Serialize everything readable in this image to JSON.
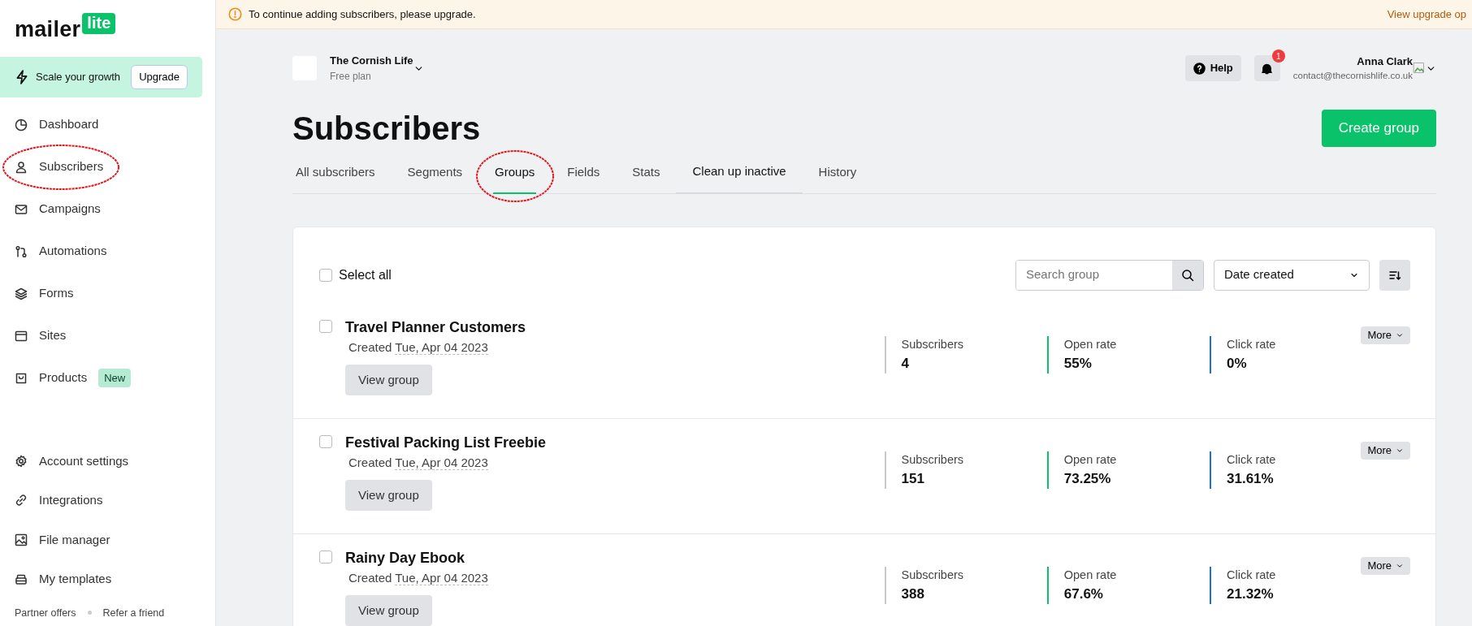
{
  "banner": {
    "text": "To continue adding subscribers, please upgrade.",
    "link": "View upgrade op"
  },
  "sidebar": {
    "logo": {
      "word": "mailer",
      "tag": "lite"
    },
    "promo": {
      "text": "Scale your growth",
      "button": "Upgrade"
    },
    "nav": [
      {
        "label": "Dashboard",
        "circled": false
      },
      {
        "label": "Subscribers",
        "circled": true
      },
      {
        "label": "Campaigns",
        "circled": false
      },
      {
        "label": "Automations",
        "circled": false
      },
      {
        "label": "Forms",
        "circled": false
      },
      {
        "label": "Sites",
        "circled": false
      },
      {
        "label": "Products",
        "circled": false,
        "badge": "New"
      }
    ],
    "settings": [
      {
        "label": "Account settings"
      },
      {
        "label": "Integrations"
      },
      {
        "label": "File manager"
      },
      {
        "label": "My templates"
      }
    ],
    "footer": [
      "Partner offers",
      "Refer a friend"
    ]
  },
  "account": {
    "name": "The Cornish Life",
    "plan": "Free plan"
  },
  "help": "Help",
  "notifications": "1",
  "user": {
    "name": "Anna Clark",
    "email": "contact@thecornishlife.co.uk"
  },
  "page_title": "Subscribers",
  "create_button": "Create group",
  "tabs": [
    {
      "label": "All subscribers",
      "selected": false,
      "circled": false
    },
    {
      "label": "Segments",
      "selected": false,
      "circled": false
    },
    {
      "label": "Groups",
      "selected": true,
      "circled": true
    },
    {
      "label": "Fields",
      "selected": false,
      "circled": false
    },
    {
      "label": "Stats",
      "selected": false,
      "circled": false
    },
    {
      "label": "Clean up inactive",
      "selected": false,
      "circled": false,
      "emphasis": true
    },
    {
      "label": "History",
      "selected": false,
      "circled": false
    }
  ],
  "toolbar": {
    "select_all": "Select all",
    "select_all_checked": false,
    "search_placeholder": "Search group",
    "sort": "Date created"
  },
  "groups": [
    {
      "name": "Travel Planner Customers",
      "created": "Created",
      "date": "Tue, Apr 04 2023",
      "checked": false,
      "view": "View group",
      "more": "More",
      "stats": [
        {
          "label": "Subscribers",
          "value": "4",
          "color": "#c8c9cc"
        },
        {
          "label": "Open rate",
          "value": "55%",
          "color": "#09c269"
        },
        {
          "label": "Click rate",
          "value": "0%",
          "color": "#1a6fe8"
        }
      ]
    },
    {
      "name": "Festival Packing List Freebie",
      "created": "Created",
      "date": "Tue, Apr 04 2023",
      "checked": false,
      "view": "View group",
      "more": "More",
      "stats": [
        {
          "label": "Subscribers",
          "value": "151",
          "color": "#c8c9cc"
        },
        {
          "label": "Open rate",
          "value": "73.25%",
          "color": "#09c269"
        },
        {
          "label": "Click rate",
          "value": "31.61%",
          "color": "#1a6fe8"
        }
      ]
    },
    {
      "name": "Rainy Day Ebook",
      "created": "Created",
      "date": "Tue, Apr 04 2023",
      "checked": false,
      "view": "View group",
      "more": "More",
      "stats": [
        {
          "label": "Subscribers",
          "value": "388",
          "color": "#c8c9cc"
        },
        {
          "label": "Open rate",
          "value": "67.6%",
          "color": "#09c269"
        },
        {
          "label": "Click rate",
          "value": "21.32%",
          "color": "#1a6fe8"
        }
      ]
    }
  ]
}
